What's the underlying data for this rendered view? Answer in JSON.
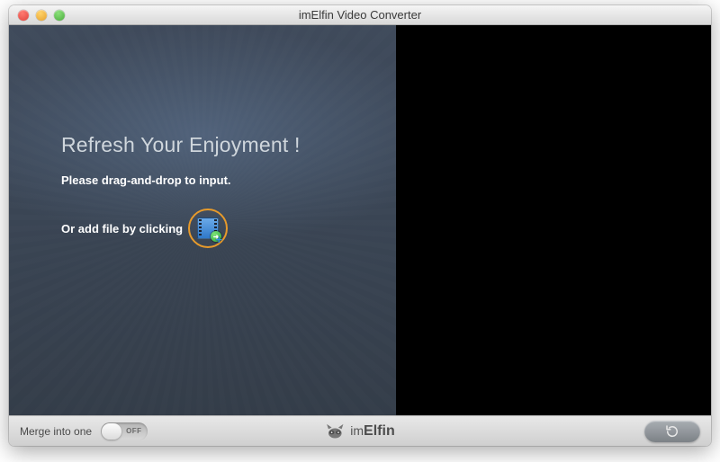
{
  "window": {
    "title": "imElfin Video Converter"
  },
  "main": {
    "headline": "Refresh Your Enjoyment !",
    "drag_hint": "Please drag-and-drop to input.",
    "click_hint": "Or add file by clicking"
  },
  "footer": {
    "merge_label": "Merge into one",
    "toggle_state": "OFF",
    "brand_prefix": "im",
    "brand_name": "Elfin"
  },
  "icons": {
    "add_file": "add-file-icon",
    "brand": "raccoon-logo",
    "convert": "refresh-arrow-icon"
  }
}
